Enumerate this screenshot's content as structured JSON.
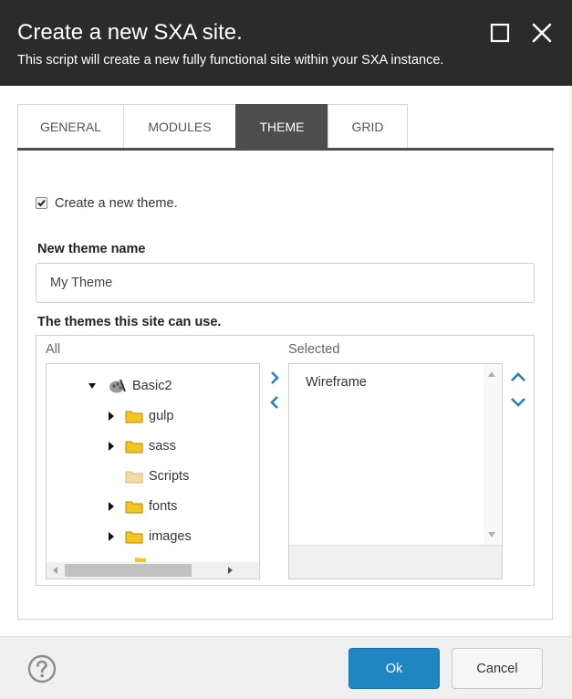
{
  "dialog": {
    "title": "Create a new SXA site.",
    "subtitle": "This script will create a new fully functional site within your SXA instance."
  },
  "tabs": [
    {
      "label": "GENERAL",
      "active": false
    },
    {
      "label": "MODULES",
      "active": false
    },
    {
      "label": "THEME",
      "active": true
    },
    {
      "label": "GRID",
      "active": false
    }
  ],
  "theme": {
    "create_checkbox_label": "Create a new theme.",
    "create_checked": true,
    "name_label": "New theme name",
    "name_value": "My Theme",
    "themes_label": "The themes this site can use.",
    "all_label": "All",
    "selected_label": "Selected",
    "tree": [
      {
        "label": "Basic2",
        "icon": "theme-palette-icon",
        "expander": "expanded"
      },
      {
        "label": "gulp",
        "icon": "folder-icon",
        "expander": "collapsed"
      },
      {
        "label": "sass",
        "icon": "folder-icon",
        "expander": "collapsed"
      },
      {
        "label": "Scripts",
        "icon": "folder-light-icon",
        "expander": "none"
      },
      {
        "label": "fonts",
        "icon": "folder-icon",
        "expander": "collapsed"
      },
      {
        "label": "images",
        "icon": "folder-icon",
        "expander": "collapsed"
      }
    ],
    "selected_items": [
      "Wireframe"
    ]
  },
  "footer": {
    "ok_label": "Ok",
    "cancel_label": "Cancel"
  },
  "colors": {
    "header_bg": "#2b2b2b",
    "active_tab": "#4d4d4d",
    "primary_button": "#1f86c1",
    "arrow_blue": "#2a7dbf",
    "folder_yellow": "#f3c623"
  }
}
